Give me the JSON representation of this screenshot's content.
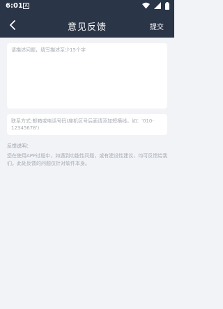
{
  "status_bar": {
    "time": "6:01",
    "app_icon": "A",
    "icons": [
      "wifi-icon",
      "signal-icon",
      "battery-icon"
    ]
  },
  "nav": {
    "back_icon": "chevron-left-icon",
    "title": "意见反馈",
    "submit_label": "提交"
  },
  "form": {
    "content_placeholder": "请描述问题，填写描述至少15个字",
    "content_value": "",
    "contact_placeholder": "联系方式:邮箱或电话号码(座机区号后面请添加短横线，如：'010-12345678')",
    "contact_value": ""
  },
  "explain": {
    "title": "反馈说明：",
    "body": "您在使用APP过程中，如遇到功能性问题，或有建设性建议，均可反馈给我们。此处反馈的问题仅针对软件本身。"
  },
  "colors": {
    "header_bg": "#2b3548",
    "page_bg": "#f1f3f7",
    "card_bg": "#ffffff",
    "placeholder": "#a6abb3"
  }
}
